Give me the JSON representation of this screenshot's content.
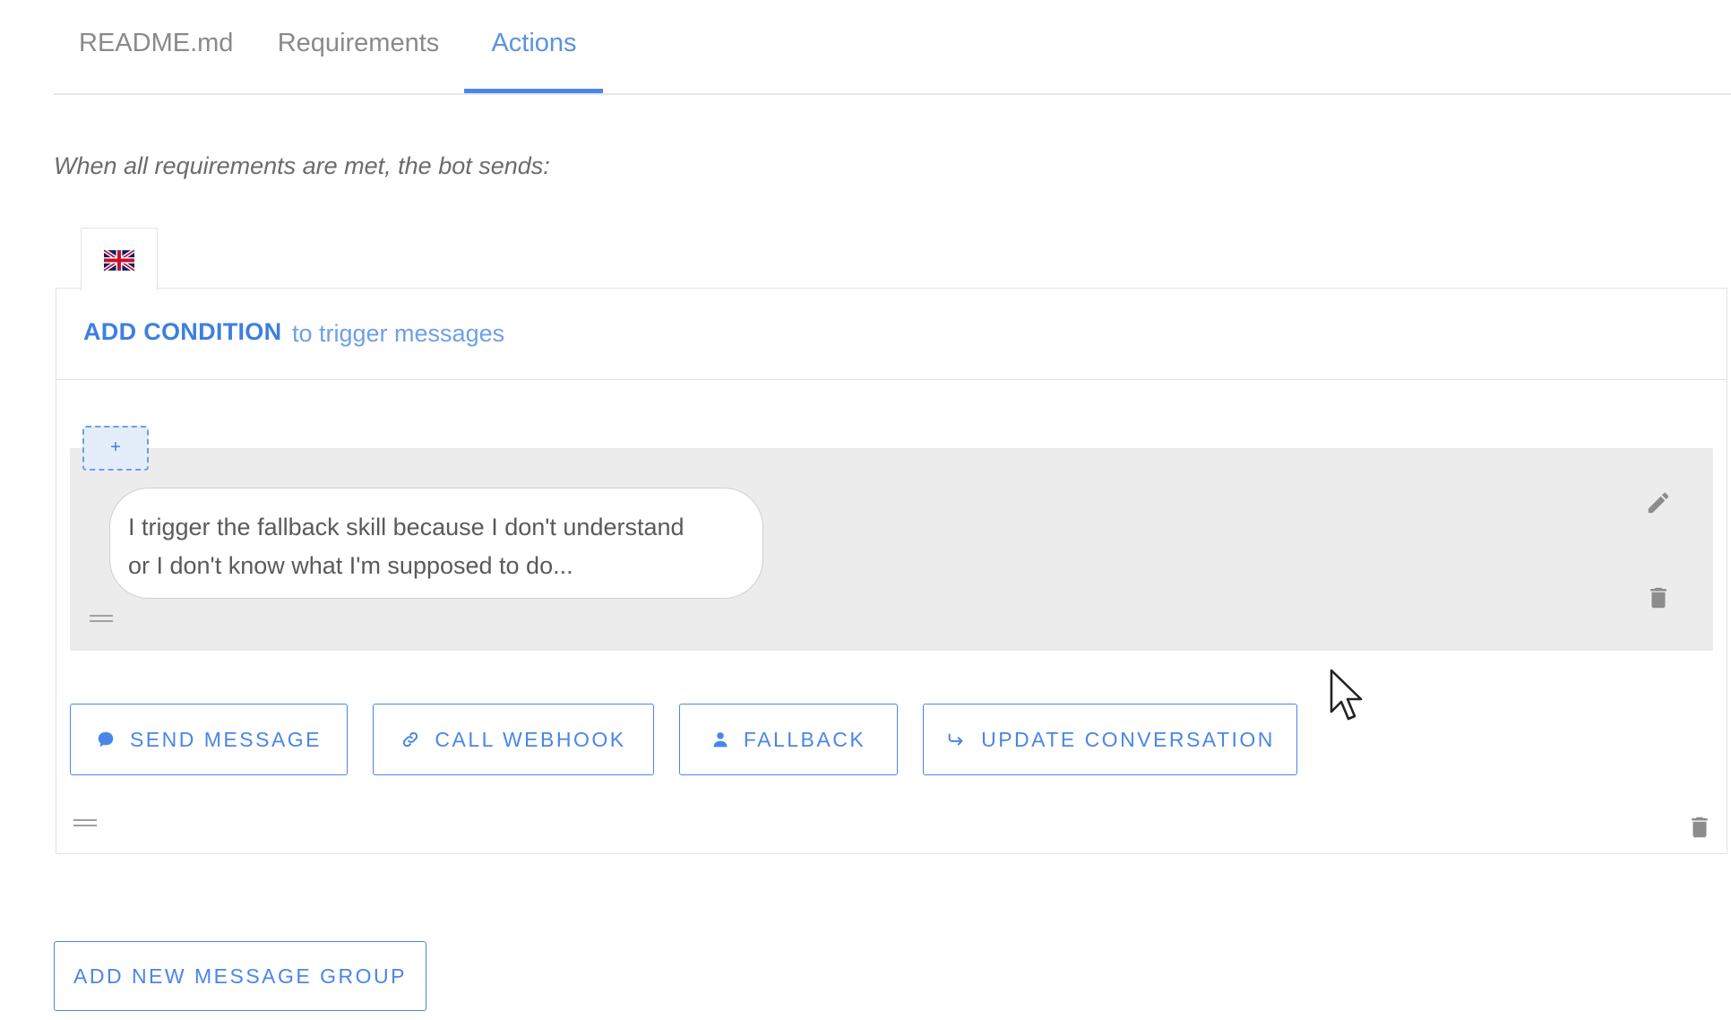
{
  "tabs": [
    {
      "label": "README.md",
      "active": false
    },
    {
      "label": "Requirements",
      "active": false
    },
    {
      "label": "Actions",
      "active": true
    }
  ],
  "intro_text": "When all requirements are met, the bot sends:",
  "language": {
    "flag_icon": "uk-flag-icon"
  },
  "condition": {
    "add_label": "ADD CONDITION",
    "trigger_text": "to trigger messages"
  },
  "message": {
    "add_button_label": "+",
    "lines": [
      "I trigger the fallback skill because I don't understand",
      "or I don't know what I'm supposed to do..."
    ]
  },
  "actions": [
    {
      "label": "SEND MESSAGE",
      "icon": "chat-bubble-icon"
    },
    {
      "label": "CALL WEBHOOK",
      "icon": "link-icon"
    },
    {
      "label": "FALLBACK",
      "icon": "person-icon"
    },
    {
      "label": "UPDATE CONVERSATION",
      "icon": "redirect-arrow-icon"
    }
  ],
  "add_group_label": "ADD NEW MESSAGE GROUP",
  "colors": {
    "accent": "#4a86e8",
    "block_bg": "#ececec",
    "border": "#e3e3e3"
  }
}
